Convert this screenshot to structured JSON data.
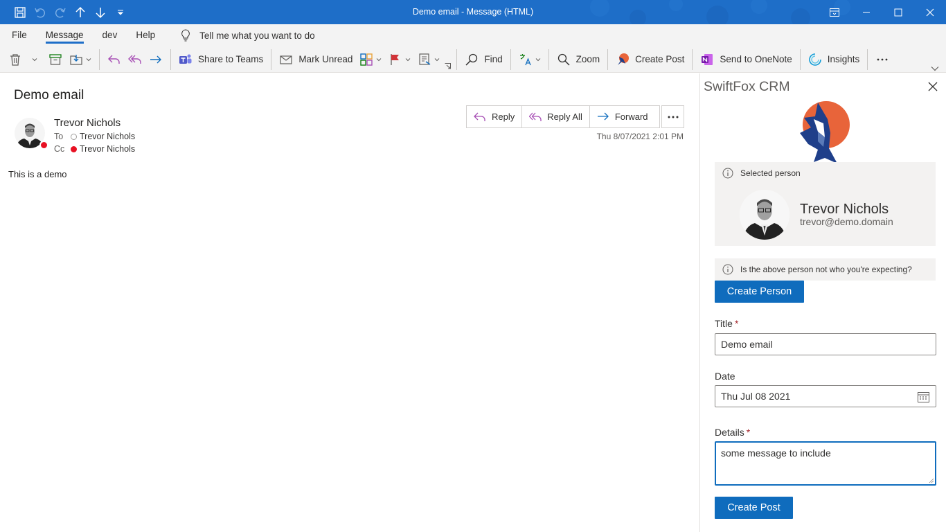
{
  "window": {
    "title": "Demo email  -  Message (HTML)"
  },
  "quick_access": {
    "icons": [
      "save-icon",
      "undo-icon",
      "redo-icon",
      "previous-item-icon",
      "next-item-icon",
      "customize-qat-icon"
    ]
  },
  "tabs": [
    {
      "label": "File"
    },
    {
      "label": "Message",
      "active": true
    },
    {
      "label": "dev"
    },
    {
      "label": "Help"
    }
  ],
  "tell_me": "Tell me what you want to do",
  "ribbon": {
    "share_to_teams": "Share to Teams",
    "mark_unread": "Mark Unread",
    "find": "Find",
    "zoom": "Zoom",
    "create_post": "Create Post",
    "send_to_onenote": "Send to OneNote",
    "insights": "Insights"
  },
  "message": {
    "subject": "Demo email",
    "sender": "Trevor Nichols",
    "to_label": "To",
    "to_name": "Trevor Nichols",
    "cc_label": "Cc",
    "cc_name": "Trevor Nichols",
    "reply": "Reply",
    "reply_all": "Reply All",
    "forward": "Forward",
    "datetime": "Thu 8/07/2021 2:01 PM",
    "body": "This is a demo"
  },
  "addin": {
    "title": "SwiftFox CRM",
    "selected_label": "Selected person",
    "person_name": "Trevor Nichols",
    "person_email": "trevor@demo.domain",
    "not_expected": "Is the above person not who you're expecting?",
    "create_person": "Create Person",
    "title_label": "Title",
    "title_value": "Demo email",
    "date_label": "Date",
    "date_value": "Thu Jul 08 2021",
    "details_label": "Details",
    "details_value": "some message to include",
    "create_post": "Create Post",
    "required_mark": "*"
  },
  "colors": {
    "titlebar": "#1e6ec8",
    "ribbon_bg": "#f3f3f3",
    "primary": "#0f6cbd",
    "presence_busy": "#e81123",
    "logo_orange": "#e8643a",
    "logo_navy": "#1f3f8a"
  }
}
